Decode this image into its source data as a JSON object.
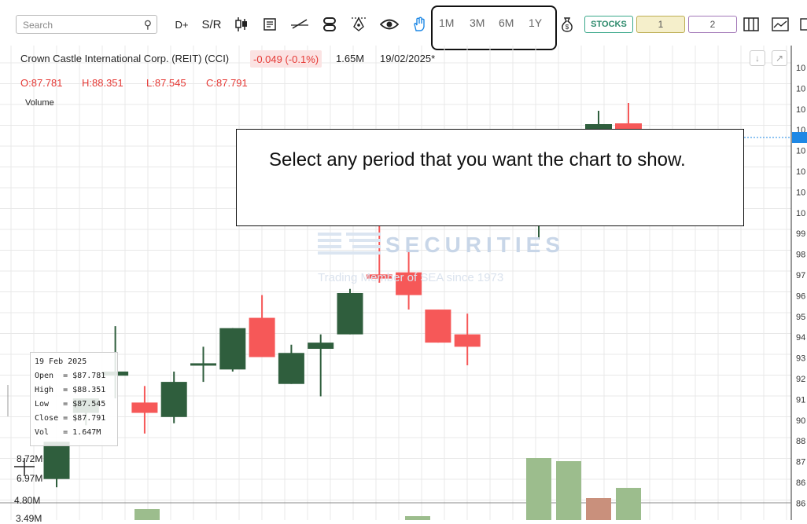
{
  "toolbar": {
    "search_placeholder": "Search",
    "d_plus": "D+",
    "sr": "S/R",
    "periods": [
      "1M",
      "3M",
      "6M",
      "1Y"
    ],
    "stocks": "STOCKS",
    "layout1": "1",
    "layout2": "2"
  },
  "header": {
    "title": "Crown Castle International Corp. (REIT) (CCI)",
    "change": "-0.049 (-0.1%)",
    "volume": "1.65M",
    "date": "19/02/2025*",
    "open": "O:87.781",
    "high": "H:88.351",
    "low": "L:87.545",
    "close": "C:87.791",
    "volume_label": "Volume"
  },
  "tooltip": {
    "date": "19 Feb 2025",
    "open": "Open  = $87.781",
    "high": "High  = $88.351",
    "low": "Low   = $87.545",
    "close": "Close = $87.791",
    "vol": "Vol   = 1.647M"
  },
  "callout": {
    "text": "Select any period that you want the chart to show."
  },
  "watermark": {
    "brand": "SECURITIES",
    "tagline": "Trading Member of SEA since 1973"
  },
  "volume_axis": [
    "8.72M",
    "6.97M",
    "4.80M",
    "3.49M"
  ],
  "colors": {
    "up": "#2f5e3d",
    "down": "#f65858",
    "vol_up": "#9cbd8d",
    "vol_down": "#c9907c",
    "grid": "#e8e8e8",
    "accent": "#1e88e5"
  },
  "chart_data": {
    "type": "candlestick",
    "price_ticks": [
      "10",
      "10",
      "10",
      "10",
      "10",
      "10",
      "10",
      "10",
      "99",
      "98",
      "97",
      "96",
      "95",
      "94",
      "93",
      "92",
      "91",
      "90",
      "88",
      "87",
      "86",
      "86"
    ],
    "candles": [
      {
        "o": 87.0,
        "h": 88.5,
        "l": 86.6,
        "c": 88.8,
        "dir": "up"
      },
      {
        "o": 90.2,
        "h": 90.6,
        "l": 89.6,
        "c": 90.9,
        "dir": "up"
      },
      {
        "o": 92.0,
        "h": 94.4,
        "l": 90.9,
        "c": 92.2,
        "dir": "up"
      },
      {
        "o": 90.7,
        "h": 91.5,
        "l": 89.2,
        "c": 90.2,
        "dir": "down"
      },
      {
        "o": 90.0,
        "h": 92.2,
        "l": 89.7,
        "c": 91.7,
        "dir": "up"
      },
      {
        "o": 92.5,
        "h": 93.4,
        "l": 91.7,
        "c": 92.6,
        "dir": "up"
      },
      {
        "o": 92.3,
        "h": 94.3,
        "l": 92.2,
        "c": 94.3,
        "dir": "up"
      },
      {
        "o": 94.8,
        "h": 95.9,
        "l": 92.9,
        "c": 92.9,
        "dir": "down"
      },
      {
        "o": 91.6,
        "h": 93.5,
        "l": 91.6,
        "c": 93.1,
        "dir": "up"
      },
      {
        "o": 93.3,
        "h": 94.0,
        "l": 91.0,
        "c": 93.6,
        "dir": "up"
      },
      {
        "o": 94.0,
        "h": 96.2,
        "l": 94.0,
        "c": 96.0,
        "dir": "up"
      },
      {
        "o": 96.9,
        "h": 99.5,
        "l": 96.5,
        "c": 96.7,
        "dir": "down"
      },
      {
        "o": 97.0,
        "h": 98.0,
        "l": 95.2,
        "c": 95.9,
        "dir": "down"
      },
      {
        "o": 95.2,
        "h": 95.2,
        "l": 93.6,
        "c": 93.6,
        "dir": "down"
      },
      {
        "o": 94.0,
        "h": 95.0,
        "l": 92.5,
        "c": 93.4,
        "dir": "down"
      }
    ],
    "volumes": [
      {
        "v": 4.9,
        "dir": "up"
      },
      {
        "v": 3.6,
        "dir": "up"
      },
      {
        "v": 4.0,
        "dir": "up"
      },
      {
        "v": 8.0,
        "dir": "up"
      },
      {
        "v": 7.9,
        "dir": "down"
      },
      {
        "v": 5.5,
        "dir": "up"
      },
      {
        "v": 5.8,
        "dir": "down"
      }
    ]
  }
}
